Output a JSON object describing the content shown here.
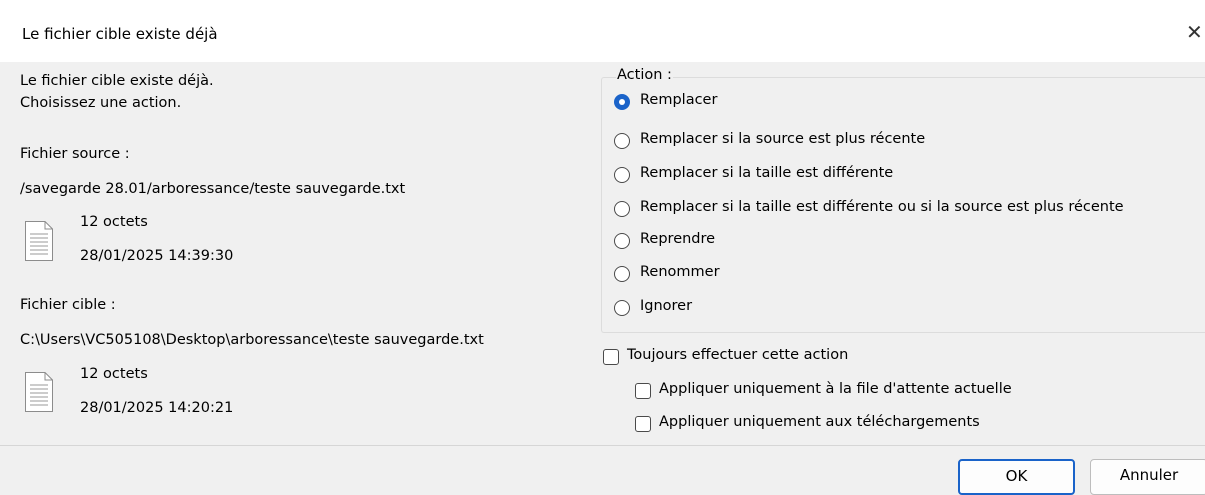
{
  "dialog": {
    "title": "Le fichier cible existe déjà",
    "close_glyph": "✕"
  },
  "message": {
    "line1": "Le fichier cible existe déjà.",
    "line2": "Choisissez une action."
  },
  "source": {
    "label": "Fichier source :",
    "path": "/savegarde 28.01/arboressance/teste sauvegarde.txt",
    "size": "12 octets",
    "date": "28/01/2025 14:39:30",
    "icon": "document-icon"
  },
  "target": {
    "label": "Fichier cible :",
    "path": "C:\\Users\\VC505108\\Desktop\\arboressance\\teste sauvegarde.txt",
    "size": "12 octets",
    "date": "28/01/2025 14:20:21",
    "icon": "document-icon"
  },
  "action": {
    "legend": "Action :",
    "selected_index": 0,
    "options": [
      "Remplacer",
      "Remplacer si la source est plus récente",
      "Remplacer si la taille est différente",
      "Remplacer si la taille est différente ou si la source est plus récente",
      "Reprendre",
      "Renommer",
      "Ignorer"
    ]
  },
  "always": {
    "label": "Toujours effectuer cette action",
    "checked": false,
    "queue_only_label": "Appliquer uniquement à la file d'attente actuelle",
    "queue_only_checked": false,
    "downloads_only_label": "Appliquer uniquement aux téléchargements",
    "downloads_only_checked": false
  },
  "buttons": {
    "ok": "OK",
    "cancel": "Annuler"
  },
  "colors": {
    "accent": "#1a63c9",
    "background": "#f0f0f0"
  }
}
